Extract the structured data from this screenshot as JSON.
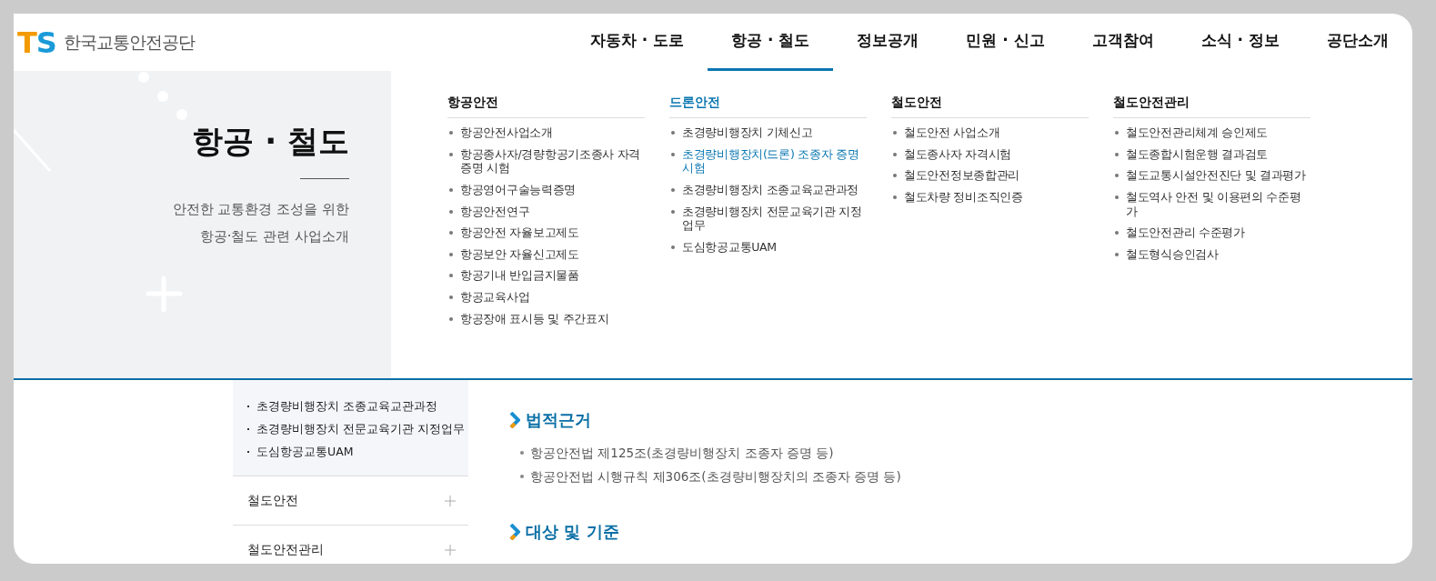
{
  "logo": {
    "mark": "TS",
    "name": "한국교통안전공단"
  },
  "nav": [
    {
      "label": "자동차 · 도로",
      "selected": false
    },
    {
      "label": "항공 · 철도",
      "selected": true
    },
    {
      "label": "정보공개",
      "selected": false
    },
    {
      "label": "민원 · 신고",
      "selected": false
    },
    {
      "label": "고객참여",
      "selected": false
    },
    {
      "label": "소식 · 정보",
      "selected": false
    },
    {
      "label": "공단소개",
      "selected": false
    }
  ],
  "mega_menu": {
    "title": "항공 · 철도",
    "subtitle_lines": [
      "안전한 교통환경 조성을 위한",
      "항공·철도 관련 사업소개"
    ],
    "columns": [
      {
        "title": "항공안전",
        "selected": false,
        "items": [
          {
            "label": "항공안전사업소개",
            "selected": false
          },
          {
            "label": "항공종사자/경량항공기조종사 자격증명 시험",
            "selected": false
          },
          {
            "label": "항공영어구술능력증명",
            "selected": false
          },
          {
            "label": "항공안전연구",
            "selected": false
          },
          {
            "label": "항공안전 자율보고제도",
            "selected": false
          },
          {
            "label": "항공보안 자율신고제도",
            "selected": false
          },
          {
            "label": "항공기내 반입금지물품",
            "selected": false
          },
          {
            "label": "항공교육사업",
            "selected": false
          },
          {
            "label": "항공장애 표시등 및 주간표지",
            "selected": false
          }
        ]
      },
      {
        "title": "드론안전",
        "selected": true,
        "items": [
          {
            "label": "초경량비행장치 기체신고",
            "selected": false
          },
          {
            "label": "초경량비행장치(드론) 조종자 증명 시험",
            "selected": true
          },
          {
            "label": "초경량비행장치 조종교육교관과정",
            "selected": false
          },
          {
            "label": "초경량비행장치 전문교육기관 지정업무",
            "selected": false
          },
          {
            "label": "도심항공교통UAM",
            "selected": false
          }
        ]
      },
      {
        "title": "철도안전",
        "selected": false,
        "items": [
          {
            "label": "철도안전 사업소개",
            "selected": false
          },
          {
            "label": "철도종사자 자격시험",
            "selected": false
          },
          {
            "label": "철도안전정보종합관리",
            "selected": false
          },
          {
            "label": "철도차량 정비조직인증",
            "selected": false
          }
        ]
      },
      {
        "title": "철도안전관리",
        "selected": false,
        "items": [
          {
            "label": "철도안전관리체계 승인제도",
            "selected": false
          },
          {
            "label": "철도종합시험운행 결과검토",
            "selected": false
          },
          {
            "label": "철도교통시설안전진단 및 결과평가",
            "selected": false
          },
          {
            "label": "철도역사 안전 및 이용편의 수준평가",
            "selected": false
          },
          {
            "label": "철도안전관리 수준평가",
            "selected": false
          },
          {
            "label": "철도형식승인검사",
            "selected": false
          }
        ]
      }
    ]
  },
  "sidebar": {
    "sub_items": [
      "초경량비행장치 조종교육교관과정",
      "초경량비행장치 전문교육기관 지정업무",
      "도심항공교통UAM"
    ],
    "sections": [
      {
        "label": "철도안전",
        "expanded": false
      },
      {
        "label": "철도안전관리",
        "expanded": false
      }
    ]
  },
  "content": [
    {
      "heading": "법적근거",
      "bullets": [
        "항공안전법 제125조(초경량비행장치 조종자 증명 등)",
        "항공안전법 시행규칙 제306조(초경량비행장치의 조종자 증명 등)"
      ]
    },
    {
      "heading": "대상 및 기준"
    }
  ]
}
